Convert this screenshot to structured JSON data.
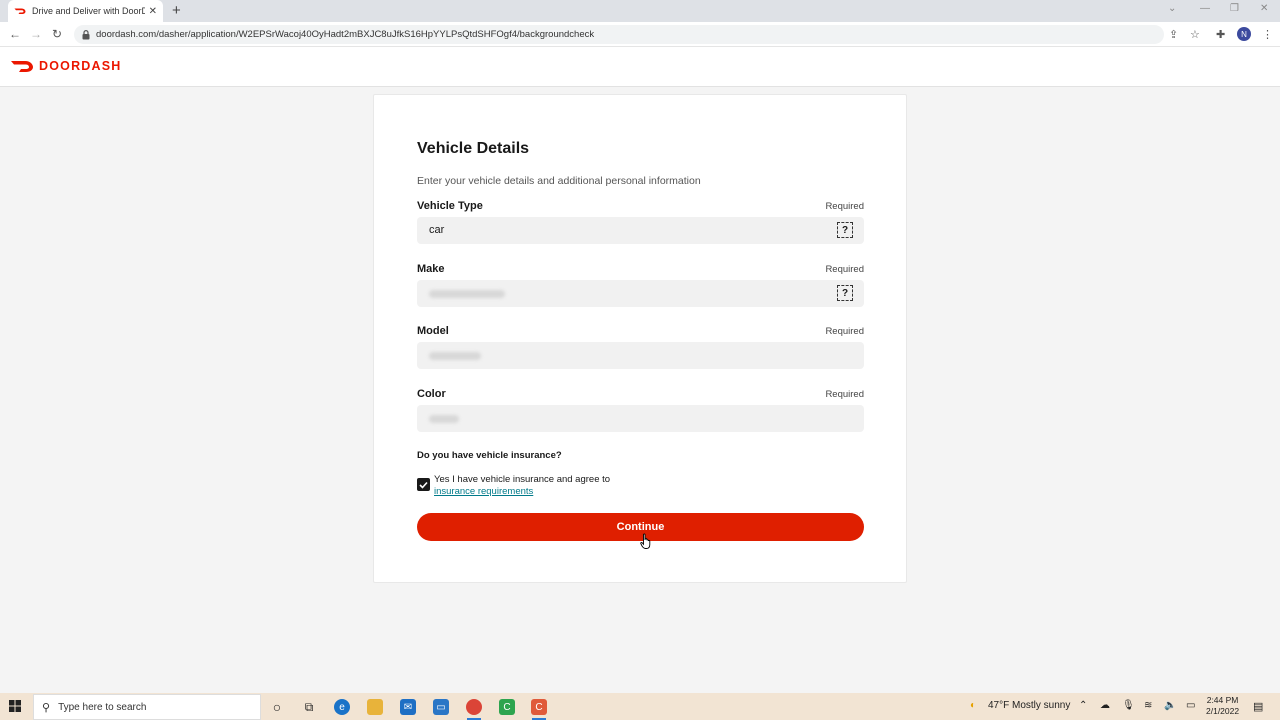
{
  "browser": {
    "tab_title": "Drive and Deliver with DoorDash",
    "tab_close": "✕",
    "new_tab": "+",
    "url": "doordash.com/dasher/application/W2EPSrWacoj40OyHadt2mBXJC8uJfkS16HpYYLPsQtdSHFOgf4/backgroundcheck",
    "profile_initial": "N"
  },
  "site": {
    "brand": "DOORDASH",
    "brand_color": "#eb1700"
  },
  "form": {
    "heading": "Vehicle Details",
    "subtitle": "Enter your vehicle details and additional personal information",
    "fields": [
      {
        "label": "Vehicle Type",
        "required": "Required",
        "value": "car",
        "help": "?"
      },
      {
        "label": "Make",
        "required": "Required",
        "value": "",
        "help": "?"
      },
      {
        "label": "Model",
        "required": "Required",
        "value": ""
      },
      {
        "label": "Color",
        "required": "Required",
        "value": ""
      }
    ],
    "insurance_question": "Do you have vehicle insurance?",
    "insurance_checked": true,
    "insurance_text": "Yes I have vehicle insurance and agree to",
    "insurance_link": "insurance requirements",
    "continue_label": "Continue",
    "button_color": "#df1f00"
  },
  "taskbar": {
    "search_placeholder": "Type here to search",
    "weather_temp": "47°F",
    "weather_text": "Mostly sunny",
    "time": "2:44 PM",
    "date": "2/1/2022"
  }
}
